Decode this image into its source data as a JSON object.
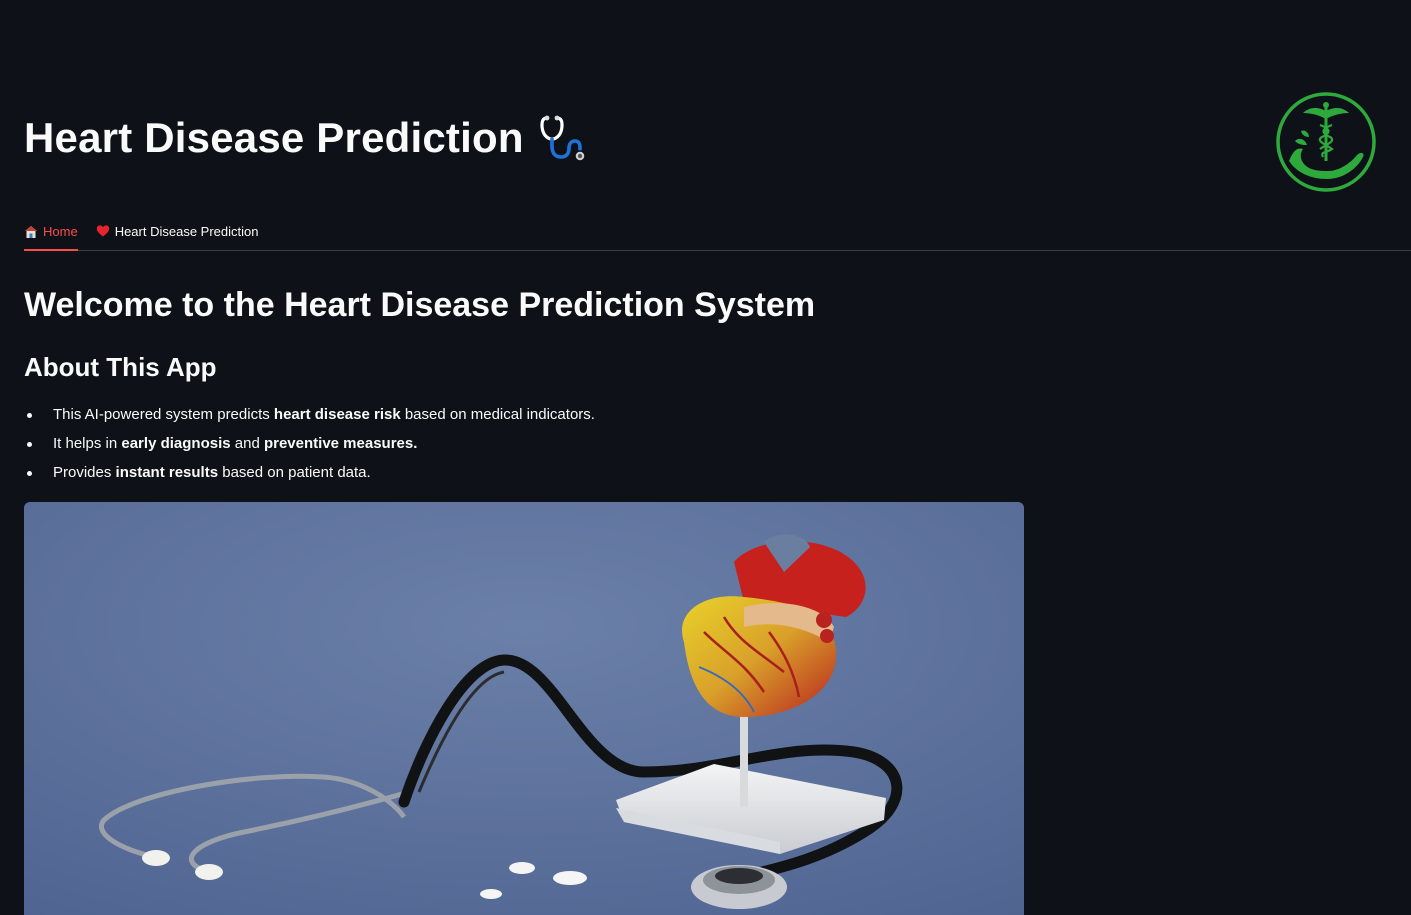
{
  "header": {
    "title": "Heart Disease Prediction",
    "title_icon": "stethoscope-icon",
    "logo_icon": "caduceus-hand-logo",
    "logo_color": "#2eaa3c"
  },
  "tabs": [
    {
      "label": "Home",
      "icon": "house-icon",
      "active": true
    },
    {
      "label": "Heart Disease Prediction",
      "icon": "heart-icon",
      "active": false
    }
  ],
  "accent_color": "#ff4b4b",
  "main": {
    "welcome_heading": "Welcome to the Heart Disease Prediction System",
    "about_heading": "About This App",
    "bullets": [
      {
        "parts": [
          "This AI-powered system predicts ",
          "heart disease risk",
          " based on medical indicators."
        ]
      },
      {
        "parts": [
          "It helps in ",
          "early diagnosis",
          " and ",
          "preventive measures",
          "."
        ]
      },
      {
        "parts": [
          "Provides ",
          "instant results",
          " based on patient data."
        ]
      }
    ],
    "hero_image": "heart-model-with-stethoscope-photo"
  }
}
